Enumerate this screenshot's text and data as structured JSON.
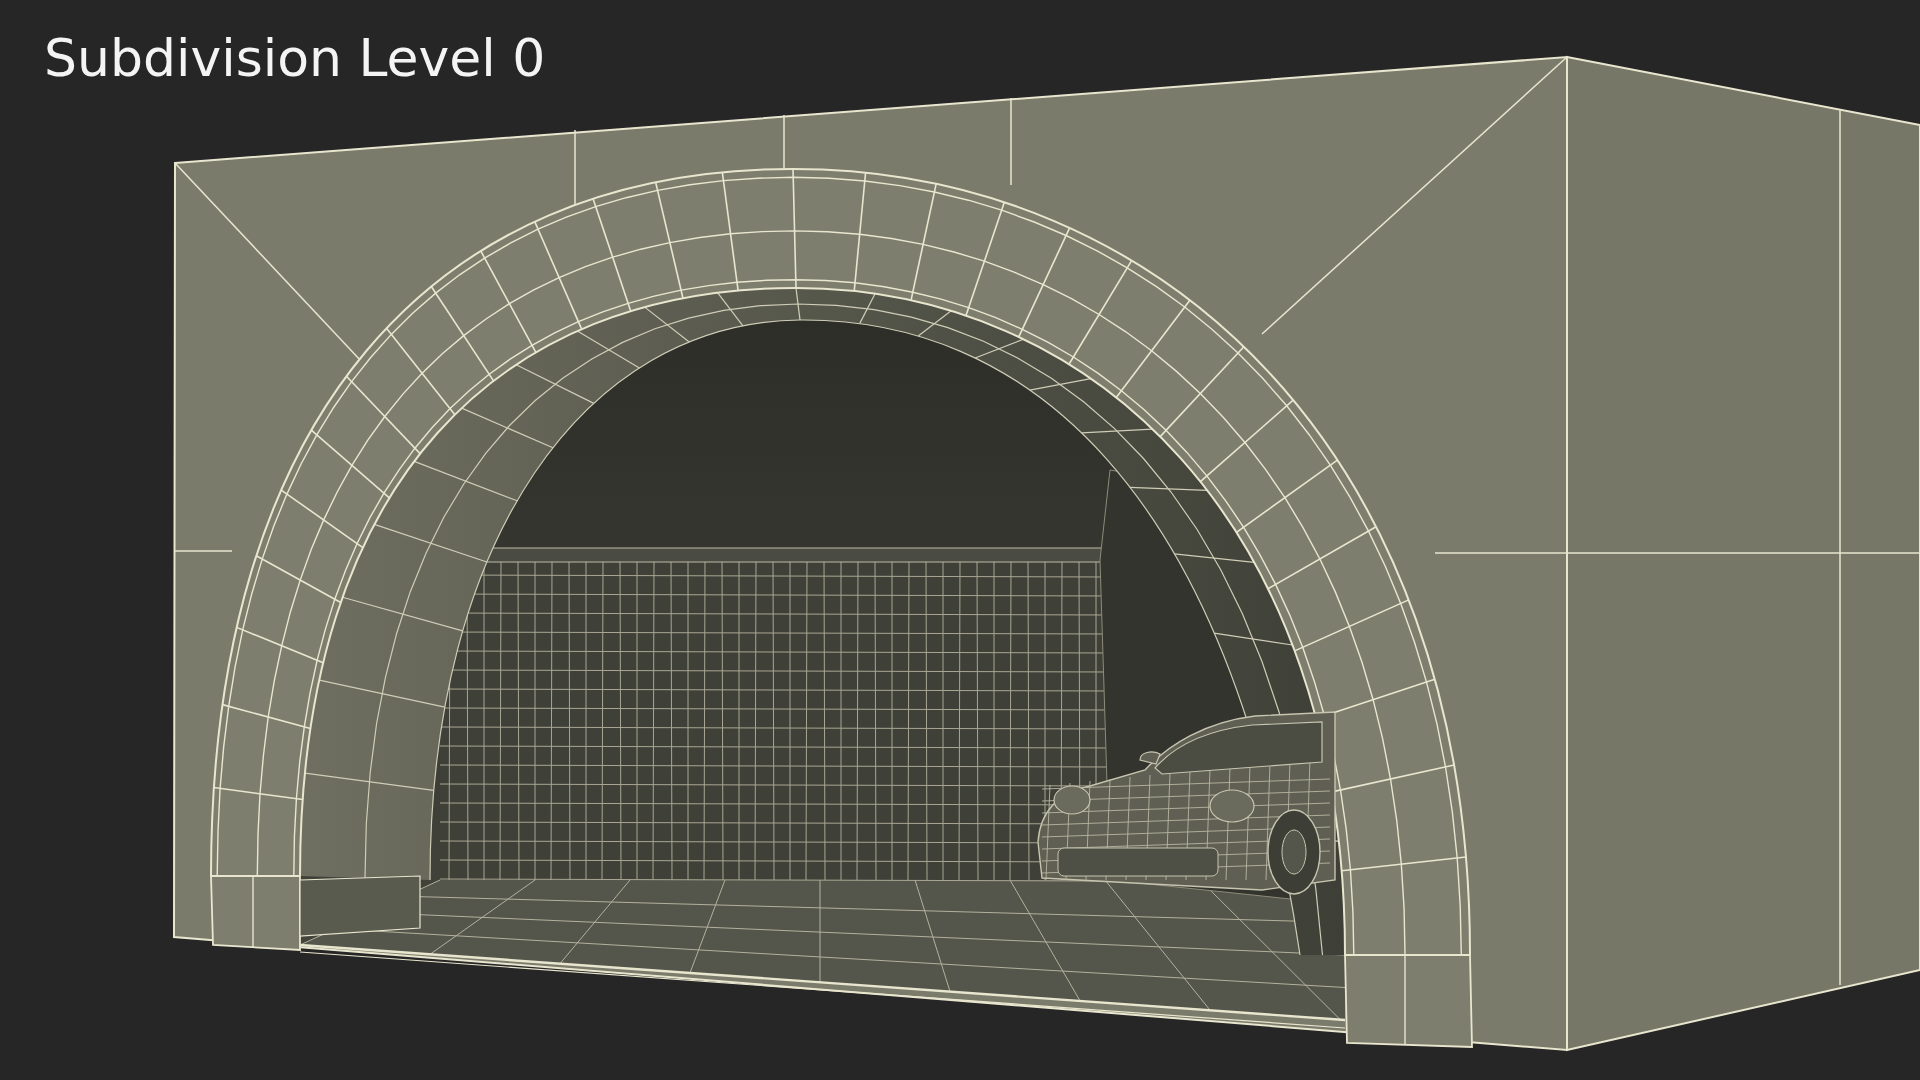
{
  "caption": "Subdivision Level 0"
}
